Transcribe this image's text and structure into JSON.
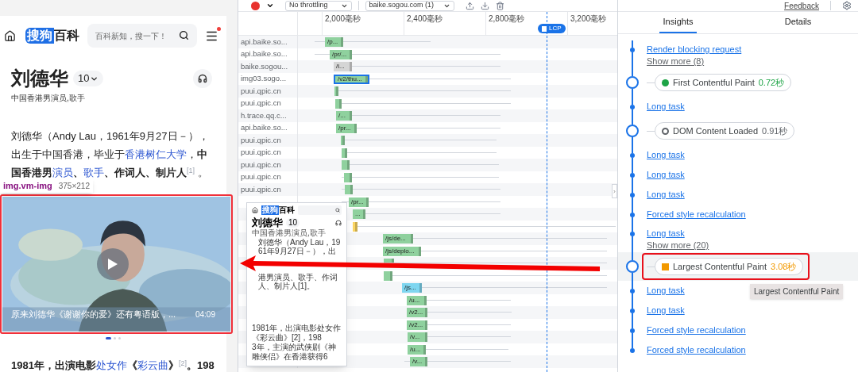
{
  "toolbar": {
    "throttling": "No throttling",
    "page_select": "baike.sogou.com (1)"
  },
  "mobile_page": {
    "logo": {
      "brand": "搜狗",
      "name": "百科"
    },
    "search": {
      "placeholder": "百科新知，搜一下！"
    },
    "menu_notification": true,
    "title": "刘德华",
    "version_badge": "10",
    "subtitle": "中国香港男演员,歌手",
    "intro": [
      {
        "text": "刘德华（Andy Lau，1961年9月27日－），出生于中国香港，毕业于",
        "kind": "plain"
      },
      {
        "text": "香港树仁大学",
        "kind": "link"
      },
      {
        "text": "，",
        "kind": "plain"
      },
      {
        "text": "中国香港男",
        "kind": "bold"
      },
      {
        "text": "演员",
        "kind": "link"
      },
      {
        "text": "、",
        "kind": "bold"
      },
      {
        "text": "歌手",
        "kind": "link"
      },
      {
        "text": "、作词人、制片人",
        "kind": "bold"
      },
      {
        "text": "[1]",
        "kind": "sup"
      },
      {
        "text": " 。",
        "kind": "plain"
      }
    ],
    "element_tooltip": {
      "selector": "img.vm-img",
      "size": "375×212"
    },
    "video": {
      "kind": "picture",
      "caption": "原来刘德华《谢谢你的爱》还有粤语版，...",
      "duration": "04:09"
    },
    "carousel_dots": [
      {
        "selected": true
      },
      {
        "selected": false
      },
      {
        "selected": false
      }
    ],
    "next_paragraph": [
      {
        "text": "1981年，出演电影",
        "kind": "bold"
      },
      {
        "text": "处女作",
        "kind": "link"
      },
      {
        "text": "《",
        "kind": "bold"
      },
      {
        "text": "彩云曲",
        "kind": "link"
      },
      {
        "text": "》",
        "kind": "bold"
      },
      {
        "text": "[2]",
        "kind": "sup"
      },
      {
        "text": "。198",
        "kind": "bold"
      }
    ]
  },
  "network": {
    "ticks": [
      "2,000毫秒",
      "2,400毫秒",
      "2,800毫秒",
      "3,200毫秒"
    ],
    "lcp_marker": "LCP",
    "rows": [
      {
        "host": "api.baike.so...",
        "bar_label": "/p...",
        "color": "#8fd19e",
        "selected": false
      },
      {
        "host": "api.baike.so...",
        "bar_label": "/pr/...",
        "color": "#8fd19e",
        "selected": false
      },
      {
        "host": "baike.sogou...",
        "bar_label": "/i...",
        "color": "#d5d5d5",
        "selected": false
      },
      {
        "host": "img03.sogo...",
        "bar_label": "/v2/thu...",
        "color": "#8fd19e",
        "selected": true
      },
      {
        "host": "puui.qpic.cn",
        "color": "#8fd19e",
        "selected": false
      },
      {
        "host": "puui.qpic.cn",
        "color": "#8fd19e",
        "selected": false
      },
      {
        "host": "h.trace.qq.c...",
        "bar_label": "/...",
        "color": "#8fd19e",
        "selected": false
      },
      {
        "host": "api.baike.so...",
        "bar_label": "/pr...",
        "color": "#8fd19e",
        "selected": false
      },
      {
        "host": "puui.qpic.cn",
        "color": "#8fd19e",
        "selected": false
      },
      {
        "host": "puui.qpic.cn",
        "color": "#8fd19e",
        "selected": false
      },
      {
        "host": "puui.qpic.cn",
        "color": "#8fd19e",
        "selected": false
      },
      {
        "host": "puui.qpic.cn",
        "color": "#8fd19e",
        "selected": false
      },
      {
        "host": "puui.qpic.cn",
        "color": "#8fd19e",
        "selected": false
      },
      {
        "bar_label": "/pr...",
        "color": "#8fd19e",
        "selected": false
      },
      {
        "bar_label": "...",
        "color": "#8fd19e",
        "selected": false
      },
      {
        "color": "#fcd663",
        "selected": false
      },
      {
        "bar_label": "/js/de...",
        "color": "#8fd19e",
        "selected": false
      },
      {
        "bar_label": "/js/deplo...",
        "color": "#8fd19e",
        "selected": false
      },
      {
        "color": "#8fd19e",
        "selected": false
      },
      {
        "color": "#8fd19e",
        "selected": false
      },
      {
        "bar_label": "/js...",
        "color": "#7fd6f0",
        "selected": false
      },
      {
        "bar_label": "/u...",
        "color": "#8fd19e",
        "selected": false
      },
      {
        "bar_label": "/v2...",
        "color": "#8fd19e",
        "selected": false
      },
      {
        "bar_label": "/v2...",
        "color": "#8fd19e",
        "selected": false
      },
      {
        "bar_label": "/v...",
        "color": "#8fd19e",
        "selected": false
      },
      {
        "bar_label": "/u...",
        "color": "#8fd19e",
        "selected": false
      },
      {
        "bar_label": "/v...",
        "color": "#8fd19e",
        "selected": false
      }
    ]
  },
  "filmstrip_preview": {
    "logo": {
      "brand": "搜狗",
      "name": "百科"
    },
    "title": "刘德华",
    "version_badge": "10",
    "subtitle": "中国香港男演员,歌手",
    "lines": [
      "刘德华（Andy Lau，1961年9月27日－），出",
      "港男演员、歌手、作词人、制片人[1]。"
    ],
    "bottom_lines": [
      "1981年，出演电影处女作《彩云曲》[2]，198",
      "3年，主演的武侠剧《神雕侠侣》在香港获得6"
    ]
  },
  "side_panel": {
    "feedback": "Feedback",
    "tabs": [
      {
        "label": "Insights",
        "selected": true
      },
      {
        "label": "Details",
        "selected": false
      }
    ],
    "items": [
      {
        "kind": "link",
        "label": "Render blocking request",
        "more": "Show more (8)"
      },
      {
        "kind": "milestone",
        "label": "First Contentful Paint",
        "value": "0.72秒",
        "marker": {
          "kind": "dot"
        },
        "color": "#1ea446",
        "highlighted": false,
        "annotated": false
      },
      {
        "kind": "link",
        "label": "Long task"
      },
      {
        "kind": "milestone",
        "label": "DOM Content Loaded",
        "value": "0.91秒",
        "marker": {
          "kind": "ring"
        },
        "color": "#5f6368",
        "highlighted": false,
        "annotated": false
      },
      {
        "kind": "link",
        "label": "Long task"
      },
      {
        "kind": "link",
        "label": "Long task"
      },
      {
        "kind": "link",
        "label": "Long task"
      },
      {
        "kind": "link",
        "label": "Forced style recalculation"
      },
      {
        "kind": "link",
        "label": "Long task",
        "more": "Show more (20)"
      },
      {
        "kind": "milestone",
        "label": "Largest Contentful Paint",
        "value": "3.08秒",
        "marker": {
          "kind": "square"
        },
        "color": "#f29900",
        "highlighted": true,
        "annotated": true,
        "tooltip": "Largest Contentful Paint"
      },
      {
        "kind": "link",
        "label": "Long task"
      },
      {
        "kind": "link",
        "label": "Long task"
      },
      {
        "kind": "link",
        "label": "Forced style recalculation"
      },
      {
        "kind": "link",
        "label": "Forced style recalculation"
      }
    ]
  }
}
